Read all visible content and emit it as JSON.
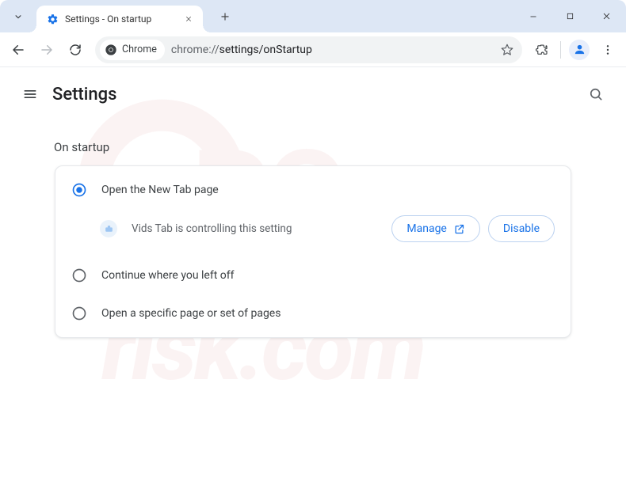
{
  "window": {
    "tab_title": "Settings - On startup"
  },
  "toolbar": {
    "chrome_chip": "Chrome",
    "url_prefix": "chrome://",
    "url_path": "settings/onStartup"
  },
  "appbar": {
    "title": "Settings"
  },
  "section": {
    "title": "On startup"
  },
  "options": {
    "open_new_tab": "Open the New Tab page",
    "extension_control": "Vids Tab is controlling this setting",
    "manage": "Manage",
    "disable": "Disable",
    "continue": "Continue where you left off",
    "specific": "Open a specific page or set of pages"
  }
}
